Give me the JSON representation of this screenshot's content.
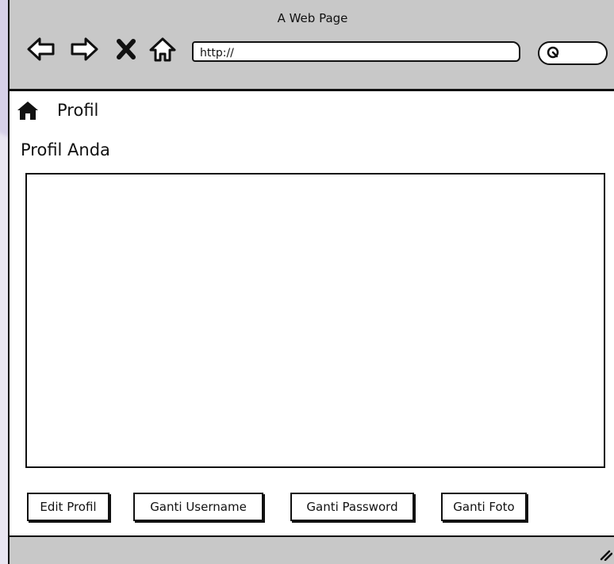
{
  "window": {
    "title": "A Web Page"
  },
  "toolbar": {
    "url": "http://",
    "icons": [
      "back-arrow-icon",
      "forward-arrow-icon",
      "close-icon",
      "home-outline-icon",
      "search-icon"
    ]
  },
  "breadcrumb": {
    "icon": "home-icon",
    "label": "Profil"
  },
  "main": {
    "section_title": "Profil Anda",
    "buttons": {
      "edit_profile": "Edit Profil",
      "change_username": "Ganti Username",
      "change_password": "Ganti Password",
      "change_photo": "Ganti Foto"
    }
  },
  "colors": {
    "chrome": "#c8c8c8",
    "ink": "#111111",
    "panel": "#ffffff"
  }
}
